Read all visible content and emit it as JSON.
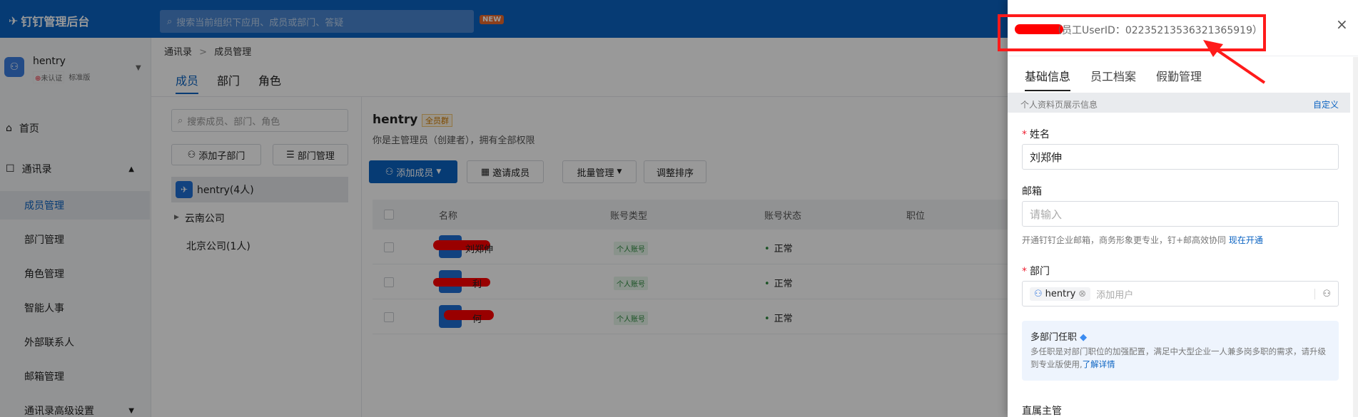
{
  "app": {
    "logo_text": "钉钉管理后台",
    "search_placeholder": "搜索当前组织下应用、成员或部门、答疑",
    "new_badge": "NEW"
  },
  "org": {
    "name": "hentry",
    "badge_unverified": "未认证",
    "badge_plan": "标准版"
  },
  "sidebar": {
    "items": [
      {
        "label": "首页"
      },
      {
        "label": "通讯录"
      },
      {
        "label": "成员管理"
      },
      {
        "label": "部门管理"
      },
      {
        "label": "角色管理"
      },
      {
        "label": "智能人事"
      },
      {
        "label": "外部联系人"
      },
      {
        "label": "邮箱管理"
      },
      {
        "label": "通讯录高级设置"
      }
    ]
  },
  "breadcrumb": {
    "parent": "通讯录",
    "separator": ">",
    "current": "成员管理"
  },
  "tabs": [
    "成员",
    "部门",
    "角色"
  ],
  "dept_panel": {
    "search_placeholder": "搜索成员、部门、角色",
    "add_sub_dept": "添加子部门",
    "dept_manage": "部门管理",
    "tree": [
      {
        "label": "hentry(4人)"
      },
      {
        "label": "云南公司"
      },
      {
        "label": "北京公司(1人)"
      }
    ]
  },
  "member_panel": {
    "title": "hentry",
    "title_tag": "全员群",
    "subtitle": "你是主管理员（创建者），拥有全部权限",
    "add_member": "添加成员",
    "invite_member": "邀请成员",
    "batch_manage": "批量管理",
    "adjust_order": "调整排序",
    "columns": [
      "名称",
      "账号类型",
      "账号状态",
      "职位"
    ],
    "rows": [
      {
        "name_suffix": "刘郑伸",
        "account_type": "个人账号",
        "status": "正常"
      },
      {
        "name_suffix": "利",
        "account_type": "个人账号",
        "status": "正常"
      },
      {
        "name_suffix": "何",
        "account_type": "个人账号",
        "status": "正常"
      }
    ]
  },
  "drawer": {
    "header_prefix": "（员工UserID：",
    "user_id": "02235213536321365919",
    "header_suffix": "）",
    "close": "×",
    "tabs": [
      "基础信息",
      "员工档案",
      "假勤管理"
    ],
    "section_hint": "个人资料页展示信息",
    "customize": "自定义",
    "name_label": "姓名",
    "name_value": "刘郑伸",
    "email_label": "邮箱",
    "email_placeholder": "请输入",
    "email_hint": "开通钉钉企业邮箱，商务形象更专业，钉+邮高效协同",
    "email_hint_link": "现在开通",
    "dept_label": "部门",
    "dept_chip": "hentry",
    "dept_add_placeholder": "添加用户",
    "multi_dept_title": "多部门任职",
    "multi_dept_desc": "多任职是对部门职位的加强配置，满足中大型企业一人兼多岗多职的需求，请升级到专业版使用,",
    "multi_dept_link": "了解详情",
    "supervisor_label": "直属主管"
  },
  "colors": {
    "brand_blue": "#0b63c2",
    "annotation_red": "#ff1a1a",
    "required_star": "#e23"
  }
}
